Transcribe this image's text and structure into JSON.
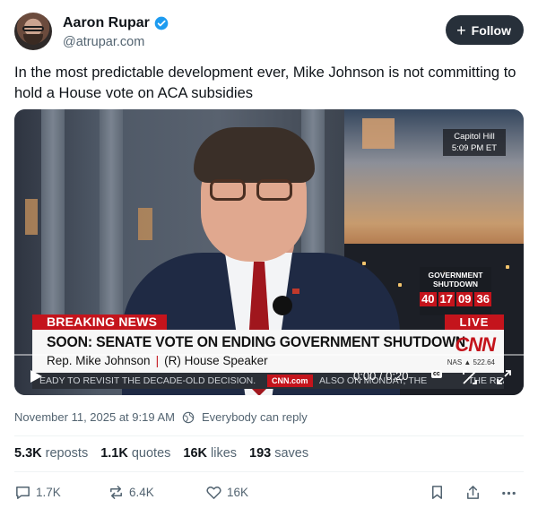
{
  "author": {
    "name": "Aaron Rupar",
    "handle": "@atrupar.com",
    "follow_label": "Follow"
  },
  "post": {
    "text": "In the most predictable development ever, Mike Johnson is not committing to hold a House vote on ACA subsidies"
  },
  "video": {
    "location": "Capitol Hill",
    "time": "5:09 PM ET",
    "shutdown_title_line1": "GOVERNMENT",
    "shutdown_title_line2": "SHUTDOWN",
    "counter": [
      "40",
      "17",
      "09",
      "36"
    ],
    "breaking": "BREAKING NEWS",
    "live": "LIVE",
    "headline": "SOON: SENATE VOTE ON ENDING GOVERNMENT SHUTDOWN",
    "speaker_name": "Rep. Mike Johnson",
    "speaker_title": "(R) House Speaker",
    "network": "CNN",
    "nas": "NAS ▲ 522.64",
    "ticker_left": "EADY TO REVISIT THE DECADE-OLD DECISION.",
    "ticker_site": "CNN.com",
    "ticker_right": "ALSO ON MONDAY, THE",
    "ticker_right2": "THE READ",
    "timecode": "0:00 / 0:20",
    "cc_label": "cc",
    "progress": 0.0
  },
  "meta": {
    "timestamp": "November 11, 2025 at 9:19 AM",
    "reply_setting": "Everybody can reply"
  },
  "stats": {
    "reposts_count": "5.3K",
    "reposts_label": "reposts",
    "quotes_count": "1.1K",
    "quotes_label": "quotes",
    "likes_count": "16K",
    "likes_label": "likes",
    "saves_count": "193",
    "saves_label": "saves"
  },
  "actions": {
    "reply_count": "1.7K",
    "repost_count": "6.4K",
    "like_count": "16K"
  },
  "colors": {
    "follow_bg": "#27303a",
    "verified": "#1d9bf0",
    "cnn_red": "#c4141c",
    "muted": "#536471"
  }
}
